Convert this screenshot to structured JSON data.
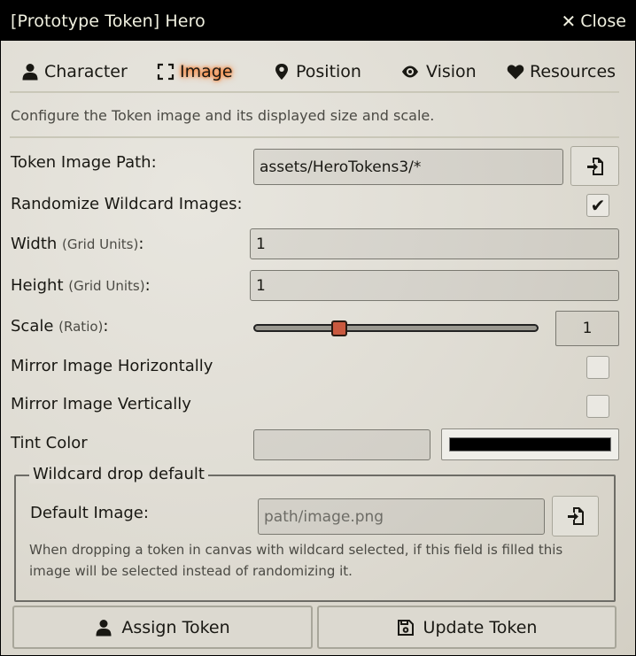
{
  "window": {
    "title": "[Prototype Token] Hero",
    "close_label": "Close"
  },
  "tabs": [
    {
      "label": "Character",
      "icon": "user-icon"
    },
    {
      "label": "Image",
      "icon": "expand-icon",
      "active": true
    },
    {
      "label": "Position",
      "icon": "map-marker-icon"
    },
    {
      "label": "Vision",
      "icon": "eye-icon"
    },
    {
      "label": "Resources",
      "icon": "heart-icon"
    }
  ],
  "hint": "Configure the Token image and its displayed size and scale.",
  "fields": {
    "image_path": {
      "label": "Token Image Path:",
      "value": "assets/HeroTokens3/*"
    },
    "randomize": {
      "label": "Randomize Wildcard Images:",
      "checked": true
    },
    "width": {
      "label": "Width",
      "units": "(Grid Units)",
      "suffix": ":",
      "value": "1"
    },
    "height": {
      "label": "Height",
      "units": "(Grid Units)",
      "suffix": ":",
      "value": "1"
    },
    "scale": {
      "label": "Scale",
      "units": "(Ratio)",
      "suffix": ":",
      "value": "1",
      "fraction": 0.29
    },
    "mirror_x": {
      "label": "Mirror Image Horizontally",
      "checked": false
    },
    "mirror_y": {
      "label": "Mirror Image Vertically",
      "checked": false
    },
    "tint": {
      "label": "Tint Color",
      "value": "",
      "color": "#000000"
    }
  },
  "wildcard": {
    "legend": "Wildcard drop default",
    "label": "Default Image:",
    "placeholder": "path/image.png",
    "notes": "When dropping a token in canvas with wildcard selected, if this field is filled this image will be selected instead of randomizing it."
  },
  "footer": {
    "assign_label": "Assign Token",
    "update_label": "Update Token"
  },
  "colors": {
    "titlebar": "#000000",
    "active_tab_glow": "#ff6400",
    "slider_thumb": "#c9593f"
  }
}
